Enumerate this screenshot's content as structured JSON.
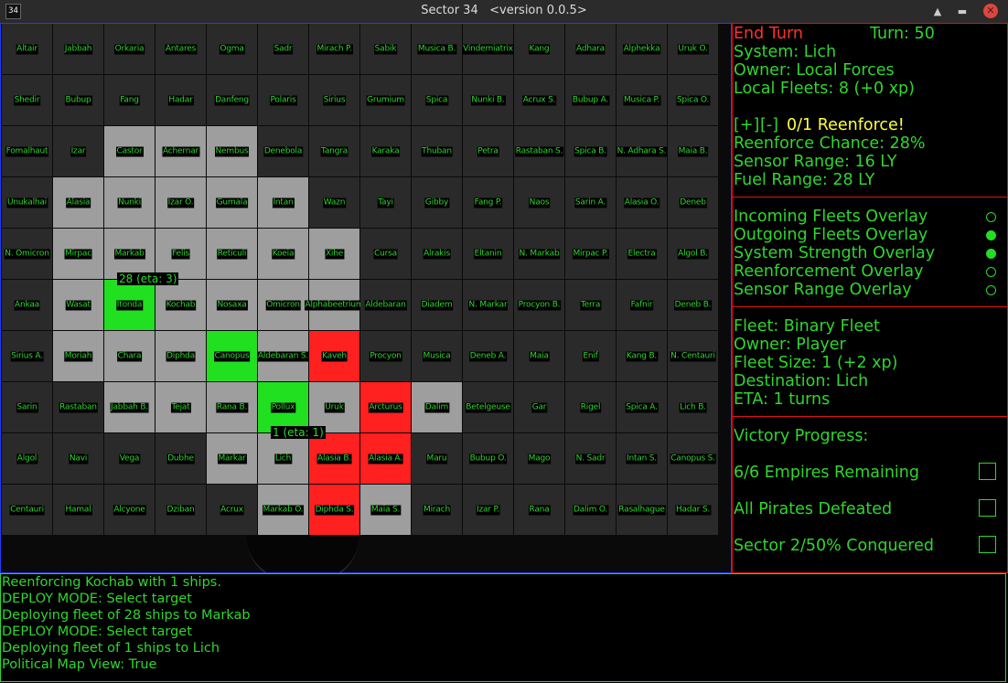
{
  "window": {
    "icon_text": "34",
    "title": "Sector 34   <version 0.0.5>",
    "buttons": {
      "shade": "▲",
      "minimize": "▬",
      "close": "✕"
    }
  },
  "map": {
    "rows": [
      [
        "Altair",
        "Jabbah",
        "Orkaria",
        "Antares",
        "Ogma",
        "Sadr",
        "Mirach P.",
        "Sabik",
        "Musica B.",
        "Vindemiatrix",
        "Kang",
        "Adhara",
        "Alphekka",
        "Uruk O."
      ],
      [
        "Shedir",
        "Bubup",
        "Fang",
        "Hadar",
        "Danfeng",
        "Polaris",
        "Sirius",
        "Grumium",
        "Spica",
        "Nunki B.",
        "Acrux S.",
        "Bubup A.",
        "Musica P.",
        "Spica O."
      ],
      [
        "Fomalhaut",
        "Izar",
        "Castor",
        "Achernar",
        "Nembus",
        "Denebola",
        "Tangra",
        "Karaka",
        "Thuban",
        "Petra",
        "Rastaban S.",
        "Spica B.",
        "N. Adhara S.",
        "Maia B."
      ],
      [
        "Unukalhai",
        "Alasia",
        "Nunki",
        "Izar O.",
        "Gumala",
        "Intan",
        "Wazn",
        "Tayi",
        "Gibby",
        "Fang P.",
        "Naos",
        "Sarin A.",
        "Alasia O.",
        "Deneb"
      ],
      [
        "N. Omicron",
        "Mirpac",
        "Markab",
        "Felis",
        "Reticuli",
        "Koeia",
        "Xihe",
        "Cursa",
        "Alrakis",
        "Eltanin",
        "N. Markab",
        "Mirpac P.",
        "Electra",
        "Algol B."
      ],
      [
        "Ankaa",
        "Wasat",
        "Itonda",
        "Kochab",
        "Nosaxa",
        "Omicron",
        "Alphabeetrium",
        "Aldebaran",
        "Diadem",
        "N. Markar",
        "Procyon B.",
        "Terra",
        "Fafnir",
        "Deneb B."
      ],
      [
        "Sirius A.",
        "Moriah",
        "Chara",
        "Diphda",
        "Canopus",
        "Aldebaran S.",
        "Kaveh",
        "Procyon",
        "Musica",
        "Deneb A.",
        "Maia",
        "Enif",
        "Kang B.",
        "N. Centauri"
      ],
      [
        "Sarin",
        "Rastaban",
        "Jabbah B.",
        "Tejat",
        "Rana B.",
        "Pollux",
        "Uruk",
        "Arcturus",
        "Dalim",
        "Betelgeuse",
        "Gar",
        "Rigel",
        "Spica A.",
        "Lich B."
      ],
      [
        "Algol",
        "Navi",
        "Vega",
        "Dubhe",
        "Markar",
        "Lich",
        "Alasia B.",
        "Alasia A.",
        "Maru",
        "Bubup O.",
        "Mago",
        "N. Sadr",
        "Intan S.",
        "Canopus S."
      ],
      [
        "Centauri",
        "Hamal",
        "Alcyone",
        "Dziban",
        "Acrux",
        "Markab O.",
        "Diphda S.",
        "Maia S.",
        "Mirach",
        "Izar P.",
        "Rana",
        "Dalim O.",
        "Rasalhague",
        "Hadar S."
      ]
    ],
    "ownership": [
      "..............",
      "..............",
      "..ggg.........",
      ".ggggg........",
      ".gggggg.......",
      ".gGgggg.......",
      ".gggGgR.......",
      "..gggGgRg.....",
      "....ggRR......",
      ".....gRg......"
    ],
    "colors": {
      "empty": "#2a2a2a",
      "gray": "#9e9e9e",
      "player": "#20e020",
      "enemy": "#ff2020"
    },
    "fleet_labels": [
      {
        "text": "28 (eta: 3)",
        "row": 5,
        "col": 2
      },
      {
        "text": "1 (eta: 1)",
        "row": 8,
        "col": 5
      }
    ]
  },
  "panel": {
    "end_turn": "End Turn",
    "turn": "Turn: 50",
    "system": "System: Lich",
    "owner": "Owner: Local Forces",
    "local_fleets": "Local Fleets: 8 (+0 xp)",
    "plus": "[+]",
    "minus": "[-]",
    "reenforce": "0/1 Reenforce!",
    "reenforce_chance": "Reenforce Chance: 28%",
    "sensor_range": "Sensor Range: 16 LY",
    "fuel_range": "Fuel Range: 28 LY",
    "overlays": [
      {
        "label": "Incoming Fleets Overlay",
        "on": false
      },
      {
        "label": "Outgoing Fleets Overlay",
        "on": true
      },
      {
        "label": "System Strength Overlay",
        "on": true
      },
      {
        "label": "Reenforcement Overlay",
        "on": false
      },
      {
        "label": "Sensor Range Overlay",
        "on": false
      }
    ],
    "fleet": {
      "name": "Fleet: Binary Fleet",
      "owner": "Owner: Player",
      "size": "Fleet Size: 1 (+2 xp)",
      "destination": "Destination: Lich",
      "eta": "ETA: 1 turns"
    },
    "victory": {
      "title": "Victory Progress:",
      "items": [
        {
          "label": "6/6 Empires Remaining",
          "checked": false
        },
        {
          "label": "All Pirates Defeated",
          "checked": false
        },
        {
          "label": "Sector 2/50% Conquered",
          "checked": false
        }
      ]
    }
  },
  "log": [
    "Reenforcing Kochab with 1 ships.",
    "DEPLOY MODE: Select target",
    "Deploying fleet of 28 ships to Markab",
    "DEPLOY MODE: Select target",
    "Deploying fleet of 1 ships to Lich",
    "Political Map View: True"
  ]
}
